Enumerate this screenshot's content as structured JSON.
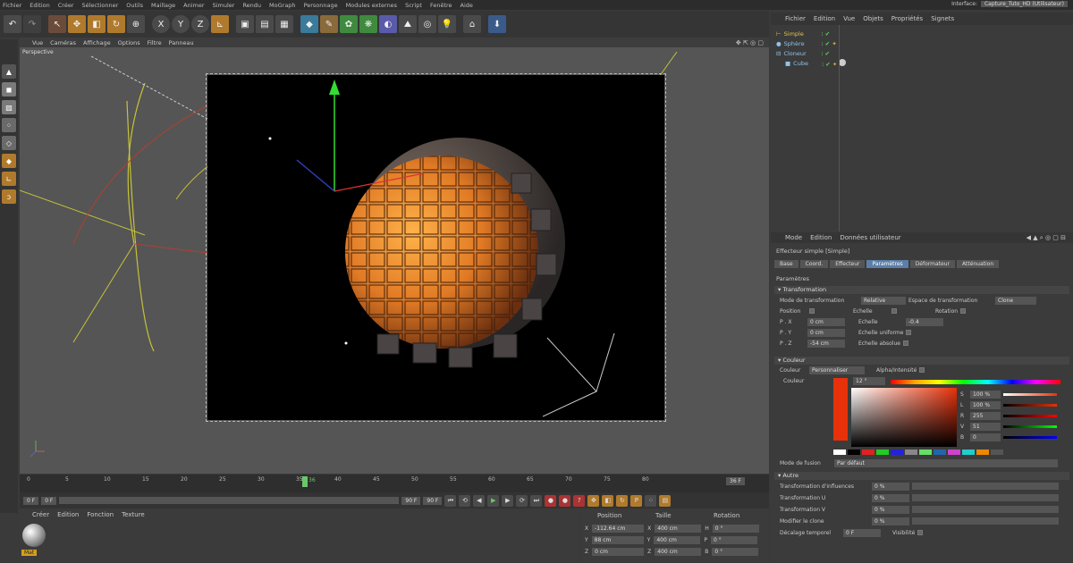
{
  "menubar": {
    "items": [
      "Fichier",
      "Edition",
      "Créer",
      "Sélectionner",
      "Outils",
      "Maillage",
      "Animer",
      "Simuler",
      "Rendu",
      "MoGraph",
      "Personnage",
      "Modules externes",
      "Script",
      "Fenêtre",
      "Aide"
    ],
    "interface_label": "Interface:",
    "interface_value": "Capture_Tuto_HD (Utilisateur)"
  },
  "viewport": {
    "menu": [
      "Vue",
      "Caméras",
      "Affichage",
      "Options",
      "Filtre",
      "Panneau"
    ],
    "label": "Perspective"
  },
  "timeline": {
    "ticks": [
      "0",
      "5",
      "10",
      "15",
      "20",
      "25",
      "30",
      "35",
      "40",
      "45",
      "50",
      "55",
      "60",
      "65",
      "70",
      "75",
      "80"
    ],
    "current_frame": "36",
    "end_field": "36 F"
  },
  "playbar": {
    "start": "0 F",
    "field2": "0 F",
    "end": "90 F",
    "end2": "90 F"
  },
  "material_panel": {
    "menu": [
      "Créer",
      "Edition",
      "Fonction",
      "Texture"
    ],
    "material_name": "Mat"
  },
  "coords": {
    "headers": [
      "Position",
      "Taille",
      "Rotation"
    ],
    "rows": [
      {
        "axis": "X",
        "pos": "-112.64 cm",
        "size_axis": "X",
        "size": "400 cm",
        "rot_axis": "H",
        "rot": "0 °"
      },
      {
        "axis": "Y",
        "pos": "88 cm",
        "size_axis": "Y",
        "size": "400 cm",
        "rot_axis": "P",
        "rot": "0 °"
      },
      {
        "axis": "Z",
        "pos": "0 cm",
        "size_axis": "Z",
        "size": "400 cm",
        "rot_axis": "B",
        "rot": "0 °"
      }
    ]
  },
  "object_manager": {
    "menu": [
      "Fichier",
      "Edition",
      "Vue",
      "Objets",
      "Propriétés",
      "Signets"
    ],
    "objects": [
      {
        "name": "Simple",
        "indent": 0,
        "color": "#e3c24a"
      },
      {
        "name": "Sphère",
        "indent": 0,
        "color": "#8fc4ea"
      },
      {
        "name": "Cloneur",
        "indent": 0,
        "color": "#8fc4ea"
      },
      {
        "name": "Cube",
        "indent": 1,
        "color": "#8fc4ea"
      }
    ]
  },
  "attributes": {
    "menu": [
      "Mode",
      "Edition",
      "Données utilisateur"
    ],
    "title": "Effecteur simple [Simple]",
    "tabs": [
      "Base",
      "Coord.",
      "Effecteur",
      "Paramètres",
      "Déformateur",
      "Atténuation"
    ],
    "active_tab": "Paramètres",
    "params_header": "Paramètres",
    "transformation_header": "Transformation",
    "mode_label": "Mode de transformation",
    "mode_value": "Relative",
    "space_label": "Espace de transformation",
    "space_value": "Clone",
    "position_label": "Position",
    "scale_label": "Echelle",
    "rotation_label": "Rotation",
    "px_label": "P . X",
    "px": "0 cm",
    "py_label": "P . Y",
    "py": "0 cm",
    "pz_label": "P . Z",
    "pz": "-54 cm",
    "echelle_label": "Echelle",
    "echelle_value": "-0.4",
    "uniform_label": "Echelle uniforme",
    "absolute_label": "Echelle absolue",
    "color_header": "Couleur",
    "color_mode_label": "Couleur",
    "color_mode_value": "Personnaliser",
    "alpha_label": "Alpha/Intensité",
    "color_label": "Couleur",
    "hue_value": "12 °",
    "hsv": [
      {
        "label": "S",
        "value": "100 %"
      },
      {
        "label": "L",
        "value": "100 %"
      },
      {
        "label": "R",
        "value": "255"
      },
      {
        "label": "V",
        "value": "51"
      },
      {
        "label": "B",
        "value": "0"
      }
    ],
    "swatch_color": "#e8310a",
    "fusion_label": "Mode de fusion",
    "fusion_value": "Par défaut",
    "other_header": "Autre",
    "other_rows": [
      {
        "label": "Transformation d'influences",
        "value": "0 %"
      },
      {
        "label": "Transformation U",
        "value": "0 %"
      },
      {
        "label": "Transformation V",
        "value": "0 %"
      },
      {
        "label": "Modifier le clone",
        "value": "0 %"
      }
    ],
    "decalage_label": "Décalage temporel",
    "decalage_value": "0 F",
    "visibility_label": "Visibilité"
  }
}
